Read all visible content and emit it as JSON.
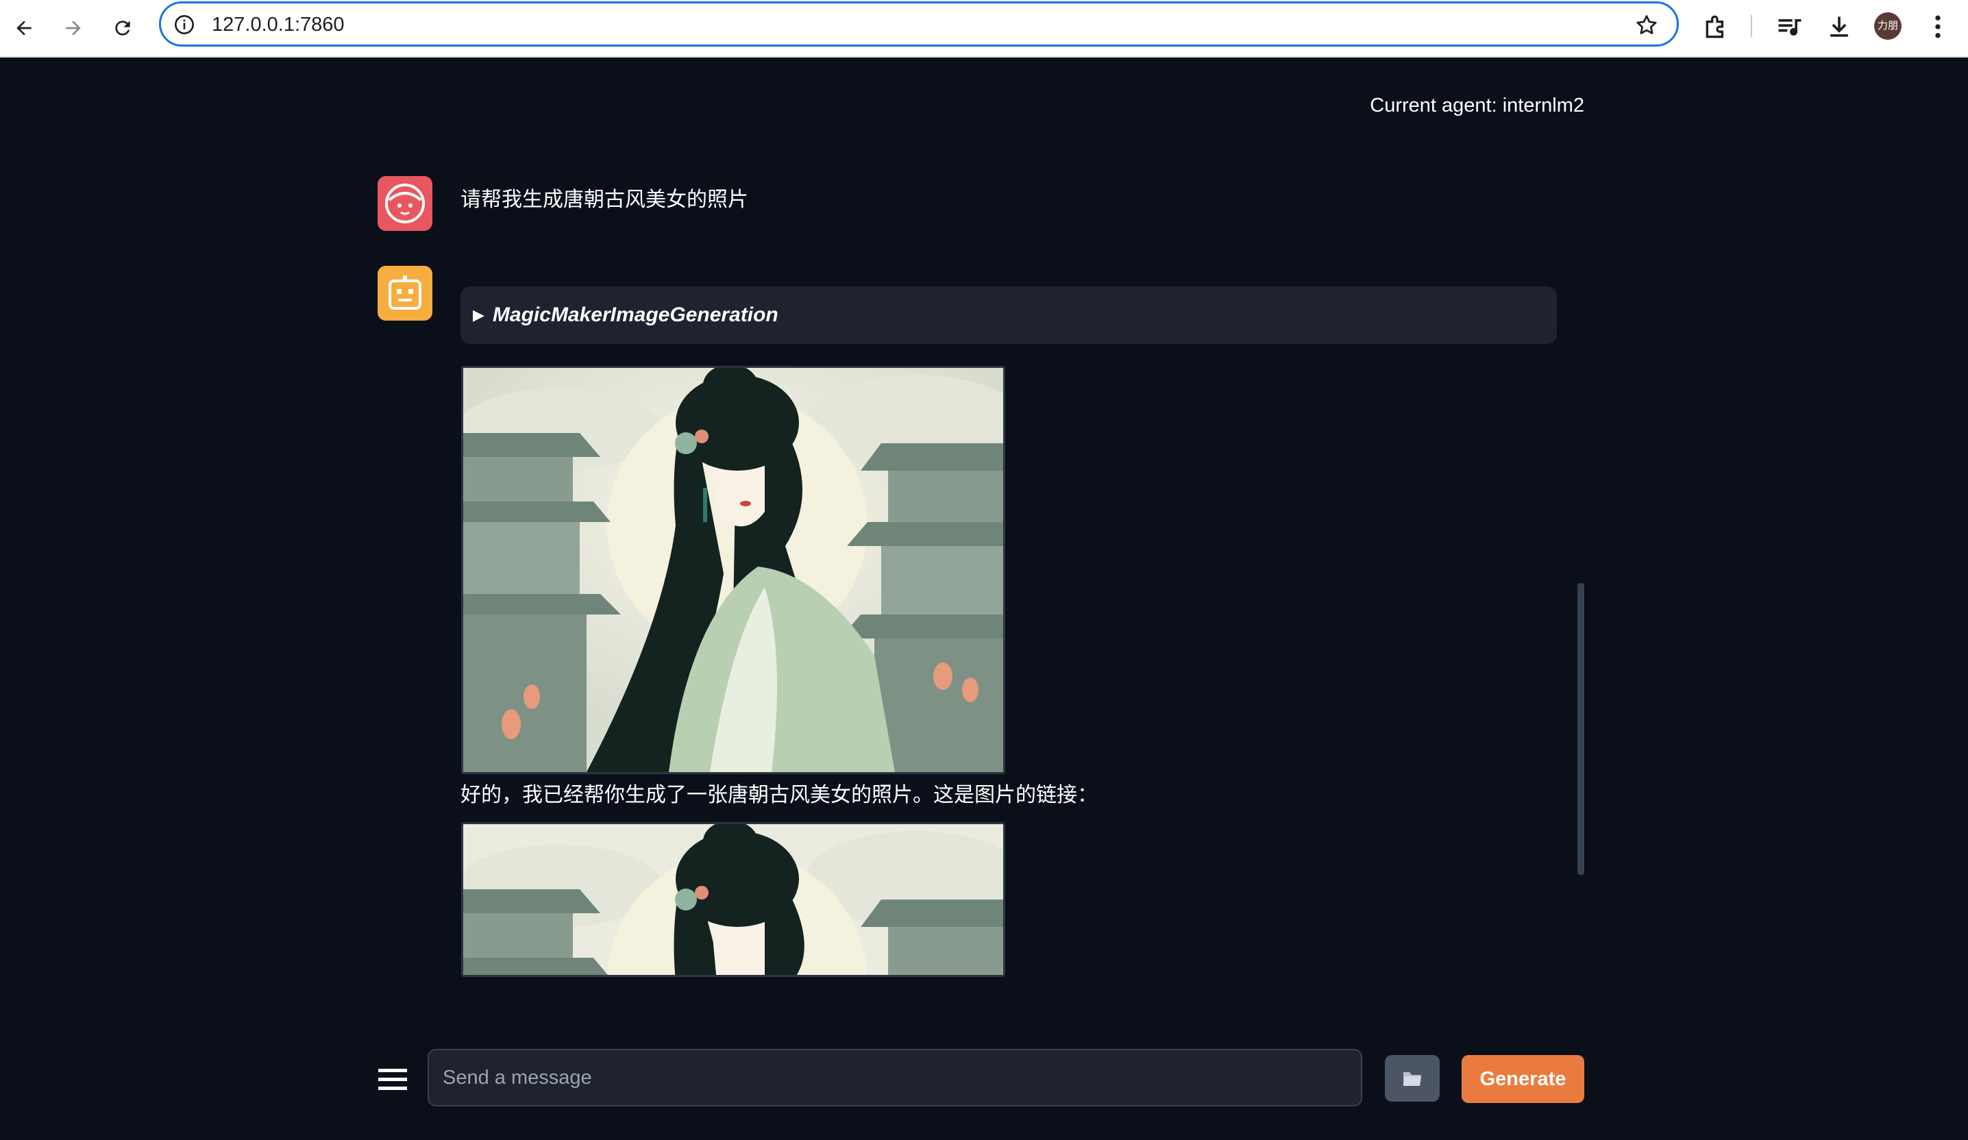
{
  "browser": {
    "url": "127.0.0.1:7860",
    "profile_initials": "力朋"
  },
  "app": {
    "current_agent": "Current agent: internlm2",
    "messages": {
      "user_text": "请帮我生成唐朝古风美女的照片",
      "tool_name": "MagicMakerImageGeneration",
      "reply_text": "好的，我已经帮你生成了一张唐朝古风美女的照片。这是图片的链接："
    },
    "input": {
      "placeholder": "Send a message"
    },
    "buttons": {
      "generate": "Generate"
    },
    "colors": {
      "background": "#0b0f19",
      "user_avatar": "#e8575f",
      "bot_avatar": "#f7ad3f",
      "generate_button": "#ea7b3e",
      "address_focus": "#1a73e8"
    }
  }
}
